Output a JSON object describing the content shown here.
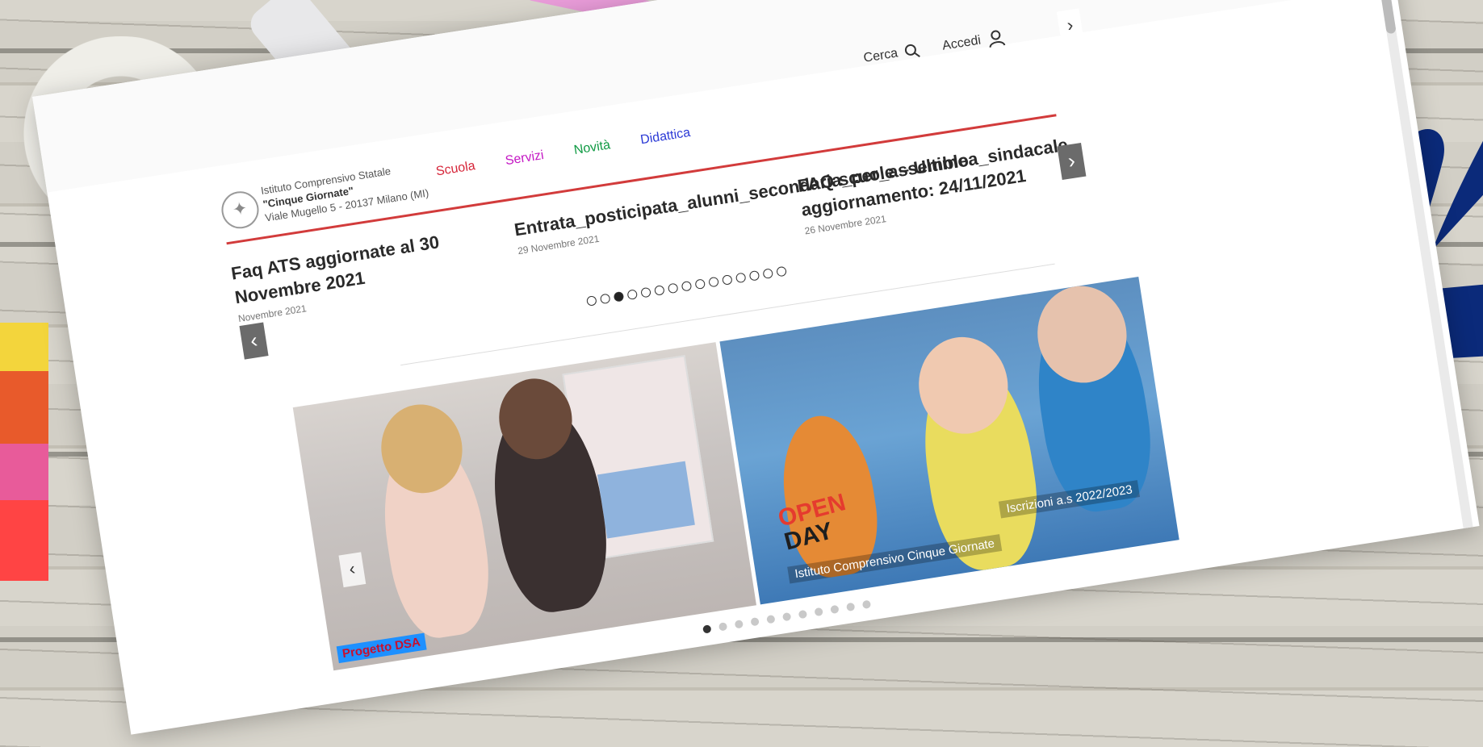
{
  "school": {
    "line1": "Istituto Comprensivo Statale",
    "line2": "\"Cinque Giornate\"",
    "line3": "Viale Mugello 5 - 20137 Milano (MI)"
  },
  "nav": {
    "scuola": "Scuola",
    "servizi": "Servizi",
    "novita": "Novità",
    "didattica": "Didattica"
  },
  "tools": {
    "search": "Cerca",
    "login": "Accedi"
  },
  "news": [
    {
      "title": "Faq ATS aggiornate al 30 Novembre 2021",
      "date": "Novembre 2021"
    },
    {
      "title": "Entrata_posticipata_alunni_secondaria_per_assemblea_sindacale",
      "date": "29 Novembre 2021"
    },
    {
      "title": "FAQ scuole – Ultimo aggiornamento: 24/11/2021",
      "date": "26 Novembre 2021"
    }
  ],
  "news_dots": 15,
  "news_active_dot": 3,
  "gallery": {
    "caption1": "Progetto DSA",
    "open1": "OPEN",
    "open2": "DAY",
    "caption2": "Istituto Comprensivo Cinque Giornate",
    "caption3": "Iscrizioni a.s 2022/2023"
  },
  "gallery_dots": 11,
  "gallery_active_dot": 1
}
